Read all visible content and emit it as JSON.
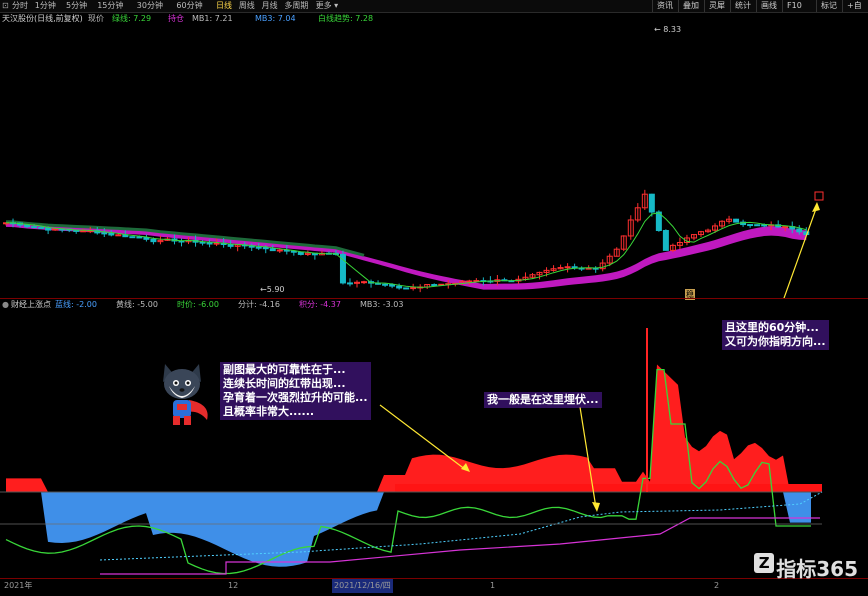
{
  "toolbar": {
    "periods": [
      "分时",
      "1分钟",
      "5分钟",
      "15分钟",
      "30分钟",
      "60分钟",
      "日线",
      "周线",
      "月线",
      "多周期",
      "更多"
    ],
    "active_period": "日线",
    "right_buttons": [
      "资讯",
      "叠加",
      "灵犀",
      "统计",
      "画线",
      "F10",
      "标记",
      "+自"
    ]
  },
  "main_header": {
    "stock_name": "天汉股份(日线,前复权)",
    "legend": [
      {
        "label": "现价",
        "value": "",
        "color": "#bdbdbd"
      },
      {
        "label": "绿线:",
        "value": "7.29",
        "color": "#39d639"
      },
      {
        "label": "持仓",
        "value": "",
        "color": "#d633d6"
      },
      {
        "label": "MB1:",
        "value": "7.21",
        "color": "#bdbdbd"
      },
      {
        "label": "MB3:",
        "value": "7.04",
        "color": "#4aa0ff"
      },
      {
        "label": "白线趋势:",
        "value": "7.28",
        "color": "#39d639"
      }
    ],
    "high_label": "8.33",
    "low_label": "←5.90"
  },
  "sub_header": {
    "indicator": "财经上涨点",
    "legend": [
      {
        "label": "蓝线:",
        "value": "-2.00",
        "color": "#4aa0ff"
      },
      {
        "label": "黄线:",
        "value": "-5.00",
        "color": "#bdbdbd"
      },
      {
        "label": "时价:",
        "value": "-6.00",
        "color": "#39d639"
      },
      {
        "label": "分计:",
        "value": "-4.16",
        "color": "#bdbdbd"
      },
      {
        "label": "积分:",
        "value": "-4.37",
        "color": "#d633d6"
      },
      {
        "label": "MB3:",
        "value": "-3.03",
        "color": "#bdbdbd"
      }
    ]
  },
  "callouts": {
    "left": [
      "副图最大的可靠性在于...",
      "连续长时间的红带出现...",
      "孕育着一次强烈拉升的可能...",
      "且概率非常大......"
    ],
    "middle": "我一般是在这里埋伏...",
    "right": [
      "且这里的60分钟...",
      "又可为你指明方向..."
    ]
  },
  "mini_badge": "稳",
  "date_axis": {
    "labels": [
      "2021年",
      "12",
      "2021/12/16/四",
      "1",
      "2"
    ]
  },
  "watermark": {
    "icon": "Z",
    "text": "指标365"
  },
  "colors": {
    "up": "#ff3030",
    "down": "#16b9c6",
    "ma_green": "#39d639",
    "band": "#c91ac9",
    "red_fill": "#ff1e1e",
    "blue_fill": "#3f8fe8",
    "purple_line": "#d633d6",
    "background": "#000000"
  }
}
